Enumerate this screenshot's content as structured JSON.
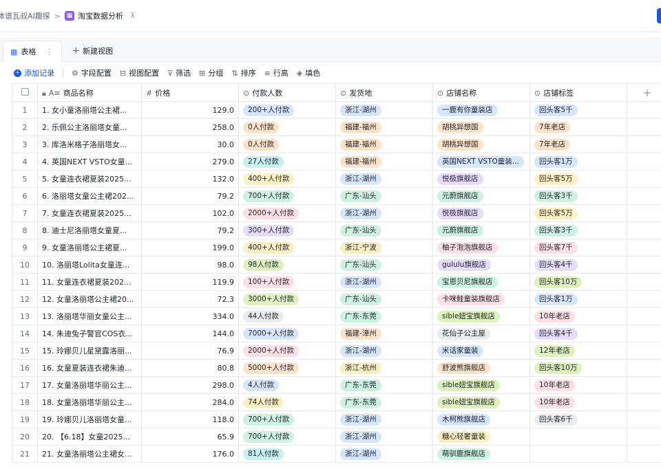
{
  "breadcrumb": {
    "parent": "体谱瓦叔AI趣探",
    "separator": ">",
    "title": "淘宝数据分析",
    "pin": "⊼"
  },
  "views": {
    "tab_label": "表格",
    "new_view": "新建视图"
  },
  "toolbar": {
    "add_record": "添加记录",
    "field_config": "字段配置",
    "view_config": "视图配置",
    "filter": "筛选",
    "group": "分组",
    "sort": "排序",
    "row_height": "行高",
    "fill_color": "填色"
  },
  "columns": {
    "name": "商品名称",
    "price": "价格",
    "pay": "付款人数",
    "ship": "发货地",
    "shop": "店铺名称",
    "tag": "店铺标签",
    "add": "+"
  },
  "colors": {
    "accent": "#1456f0",
    "tag_blue": "#d6e6ff",
    "tag_orange": "#fee3c8",
    "tag_green": "#cdf2e2",
    "tag_yellow": "#fdf0c2",
    "tag_purple": "#e6dcff",
    "tag_pink": "#fde0e6",
    "tag_lime": "#ddf2bc",
    "tag_gray": "#ebecee",
    "tag_teal": "#c8f0ee"
  },
  "rows": [
    {
      "idx": "1",
      "name": "1. 女小童洛丽塔公主裙...",
      "price": "129.0",
      "pay": "200+人付款",
      "payc": "blue",
      "ship": "浙江-湖州",
      "shipc": "blue",
      "shop": "一鹿有你童装店",
      "shopc": "blue",
      "tag": "回头客5千",
      "tagc": "blue"
    },
    {
      "idx": "2",
      "name": "2. 乐佩公主洛丽塔女童...",
      "price": "258.0",
      "pay": "0人付款",
      "payc": "orange",
      "ship": "福建-福州",
      "shipc": "orange",
      "shop": "胡桃异想国",
      "shopc": "orange",
      "tag": "7年老店",
      "tagc": "orange"
    },
    {
      "idx": "3",
      "name": "3. 库洛米格子洛丽塔女...",
      "price": "30.0",
      "pay": "0人付款",
      "payc": "orange",
      "ship": "福建-福州",
      "shipc": "orange",
      "shop": "胡桃异想国",
      "shopc": "orange",
      "tag": "7年老店",
      "tagc": "orange"
    },
    {
      "idx": "4",
      "name": "4. 英国NEXT VSTO女童...",
      "price": "279.0",
      "pay": "27人付款",
      "payc": "teal",
      "ship": "福建-福州",
      "shipc": "orange",
      "shop": "英国NEXT VSTO童装...",
      "shopc": "blue",
      "tag": "回头客1万",
      "tagc": "blue"
    },
    {
      "idx": "5",
      "name": "5. 女童连衣裙夏装2025...",
      "price": "132.0",
      "pay": "400+人付款",
      "payc": "yellow",
      "ship": "浙江-湖州",
      "shipc": "blue",
      "shop": "悦极旗舰店",
      "shopc": "purple",
      "tag": "回头客5万",
      "tagc": "yellow"
    },
    {
      "idx": "6",
      "name": "6. 洛丽塔女童公主裙202...",
      "price": "79.2",
      "pay": "700+人付款",
      "payc": "green",
      "ship": "广东-汕头",
      "shipc": "green",
      "shop": "元蔚旗舰店",
      "shopc": "green",
      "tag": "回头客3千",
      "tagc": "green"
    },
    {
      "idx": "7",
      "name": "7. 女童连衣裙夏装2025...",
      "price": "102.0",
      "pay": "2000+人付款",
      "payc": "pink",
      "ship": "浙江-湖州",
      "shipc": "blue",
      "shop": "悦极旗舰店",
      "shopc": "purple",
      "tag": "回头客5万",
      "tagc": "yellow"
    },
    {
      "idx": "8",
      "name": "8. 迪士尼洛丽塔女童夏...",
      "price": "79.2",
      "pay": "300+人付款",
      "payc": "purple",
      "ship": "广东-汕头",
      "shipc": "green",
      "shop": "元蔚旗舰店",
      "shopc": "green",
      "tag": "回头客3千",
      "tagc": "green"
    },
    {
      "idx": "9",
      "name": "9. 女童洛丽塔公主裙夏...",
      "price": "199.0",
      "pay": "400+人付款",
      "payc": "yellow",
      "ship": "浙江-宁波",
      "shipc": "yellow",
      "shop": "柚子泡泡旗舰店",
      "shopc": "pink",
      "tag": "回头客7千",
      "tagc": "pink"
    },
    {
      "idx": "10",
      "name": "10. 洛丽塔Lolita女童连...",
      "price": "98.0",
      "pay": "98人付款",
      "payc": "lime",
      "ship": "广东-汕头",
      "shipc": "green",
      "shop": "gululu旗舰店",
      "shopc": "purple",
      "tag": "回头客4千",
      "tagc": "purple"
    },
    {
      "idx": "11",
      "name": "11. 女童连衣裙夏装202...",
      "price": "119.9",
      "pay": "100+人付款",
      "payc": "pink",
      "ship": "浙江-湖州",
      "shipc": "blue",
      "shop": "宝恩贝尼旗舰店",
      "shopc": "green",
      "tag": "回头客10万",
      "tagc": "lime"
    },
    {
      "idx": "12",
      "name": "12. 女童洛丽塔公主裙20...",
      "price": "72.3",
      "pay": "3000+人付款",
      "payc": "lime",
      "ship": "广东-汕头",
      "shipc": "green",
      "shop": "卡咪鲑童装旗舰店",
      "shopc": "pink",
      "tag": "回头客1万",
      "tagc": "blue"
    },
    {
      "idx": "13",
      "name": "13. 洛丽塔华丽女童公主...",
      "price": "334.0",
      "pay": "44人付款",
      "payc": "gray",
      "ship": "广东-东莞",
      "shipc": "green",
      "shop": "sible妞宝旗舰店",
      "shopc": "lime",
      "tag": "10年老店",
      "tagc": "pink"
    },
    {
      "idx": "14",
      "name": "14. 朱迪兔子警官COS衣...",
      "price": "144.0",
      "pay": "7000+人付款",
      "payc": "blue",
      "ship": "福建-漳州",
      "shipc": "orange",
      "shop": "花仙子公主屋",
      "shopc": "gray",
      "tag": "回头客4千",
      "tagc": "purple"
    },
    {
      "idx": "15",
      "name": "15. 玲娜贝儿星黛露洛丽...",
      "price": "76.9",
      "pay": "2000+人付款",
      "payc": "pink",
      "ship": "浙江-湖州",
      "shipc": "blue",
      "shop": "米话家童装",
      "shopc": "blue",
      "tag": "12年老店",
      "tagc": "lime"
    },
    {
      "idx": "16",
      "name": "16. 女童夏装连衣裙朱迪...",
      "price": "80.8",
      "pay": "5000+人付款",
      "payc": "orange",
      "ship": "浙江-杭州",
      "shipc": "yellow",
      "shop": "舒波熊旗舰店",
      "shopc": "orange",
      "tag": "回头客10万",
      "tagc": "lime"
    },
    {
      "idx": "17",
      "name": "17. 女童洛丽塔华丽公主...",
      "price": "298.0",
      "pay": "4人付款",
      "payc": "blue",
      "ship": "广东-东莞",
      "shipc": "green",
      "shop": "sible妞宝旗舰店",
      "shopc": "lime",
      "tag": "10年老店",
      "tagc": "pink"
    },
    {
      "idx": "18",
      "name": "18. 女童洛丽塔华丽公主...",
      "price": "284.0",
      "pay": "74人付款",
      "payc": "yellow",
      "ship": "广东-东莞",
      "shipc": "green",
      "shop": "sible妞宝旗舰店",
      "shopc": "lime",
      "tag": "10年老店",
      "tagc": "pink"
    },
    {
      "idx": "19",
      "name": "19. 玲娜贝儿洛丽塔女童...",
      "price": "118.0",
      "pay": "700+人付款",
      "payc": "green",
      "ship": "浙江-湖州",
      "shipc": "blue",
      "shop": "木柯熊旗舰店",
      "shopc": "blue",
      "tag": "回头客6千",
      "tagc": "gray"
    },
    {
      "idx": "20",
      "name": "20. 【6.18】女童2025...",
      "price": "65.9",
      "pay": "700+人付款",
      "payc": "green",
      "ship": "浙江-湖州",
      "shipc": "blue",
      "shop": "糖心轻奢童装",
      "shopc": "yellow",
      "tag": "",
      "tagc": "gray"
    },
    {
      "idx": "21",
      "name": "21. 女童洛丽塔公主裙女...",
      "price": "176.0",
      "pay": "81人付款",
      "payc": "teal",
      "ship": "浙江-湖州",
      "shipc": "blue",
      "shop": "萌驯鹿旗舰店",
      "shopc": "green",
      "tag": "",
      "tagc": "gray"
    }
  ]
}
